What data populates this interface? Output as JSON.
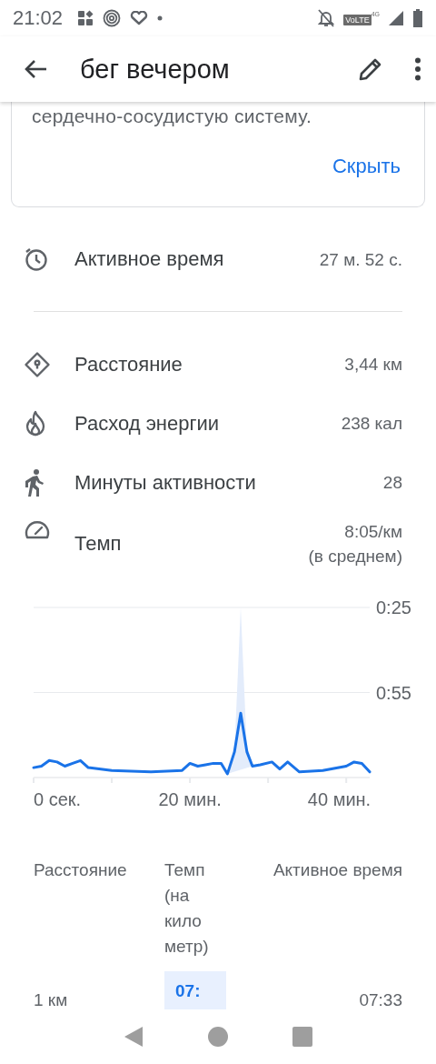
{
  "status_bar": {
    "time": "21:02",
    "volte": "VoLTE",
    "network": "4G"
  },
  "app_bar": {
    "title": "бег вечером"
  },
  "info_card": {
    "text": "сердечно-сосудистую систему.",
    "action": "Скрыть"
  },
  "active_time": {
    "kind": "timer",
    "label": "Активное время",
    "value": "27 м. 52 с."
  },
  "stats": [
    {
      "kind": "distance",
      "label": "Расстояние",
      "value": "3,44 км"
    },
    {
      "kind": "energy",
      "label": "Расход энергии",
      "value": "238 кал"
    },
    {
      "kind": "minutes",
      "label": "Минуты активности",
      "value": "28"
    },
    {
      "kind": "pace",
      "label": "Темп",
      "value": "8:05/км",
      "note": "(в среднем)"
    }
  ],
  "chart_data": {
    "type": "line",
    "x": [
      0,
      1,
      2,
      3,
      4,
      5,
      6,
      7,
      10,
      15,
      19,
      20,
      21,
      22,
      23,
      24,
      24.8,
      25.7,
      26.5,
      27.3,
      28,
      29,
      30.5,
      31.5,
      32.5,
      34,
      37,
      40,
      41,
      42,
      43
    ],
    "series": [
      {
        "color": "#1a73e8",
        "values": [
          81.5,
          81,
          79,
          79.5,
          81,
          80,
          79,
          81.5,
          82.5,
          83,
          82.5,
          80,
          81,
          80.5,
          80,
          80,
          83.7,
          76,
          62.3,
          76,
          81,
          80.5,
          79.5,
          82,
          79.5,
          83,
          82.5,
          81,
          79.5,
          80,
          83
        ]
      },
      {
        "type": "area",
        "color": "#e3ecfb",
        "values": [
          null,
          null,
          null,
          null,
          null,
          null,
          null,
          null,
          null,
          null,
          null,
          null,
          null,
          null,
          null,
          null,
          83.7,
          76,
          25,
          76,
          81,
          null,
          null,
          null,
          null,
          null,
          null,
          null,
          null,
          null,
          null
        ]
      }
    ],
    "xlim": [
      0,
      43
    ],
    "ylim": [
      85,
      25
    ],
    "xticks": [
      {
        "value": 0,
        "label": "0 сек."
      },
      {
        "value": 20,
        "label": "20 мин."
      },
      {
        "value": 40,
        "label": "40 мин."
      }
    ],
    "yticks": [
      {
        "value": 25,
        "label": "0:25"
      },
      {
        "value": 55,
        "label": "0:55"
      }
    ]
  },
  "splits": {
    "columns": [
      "Расстояние",
      "Темп (на километр)",
      "Активное время"
    ],
    "rows": [
      {
        "distance": "1 км",
        "pace": "07:",
        "time": "07:33",
        "highlighted": true
      }
    ]
  }
}
